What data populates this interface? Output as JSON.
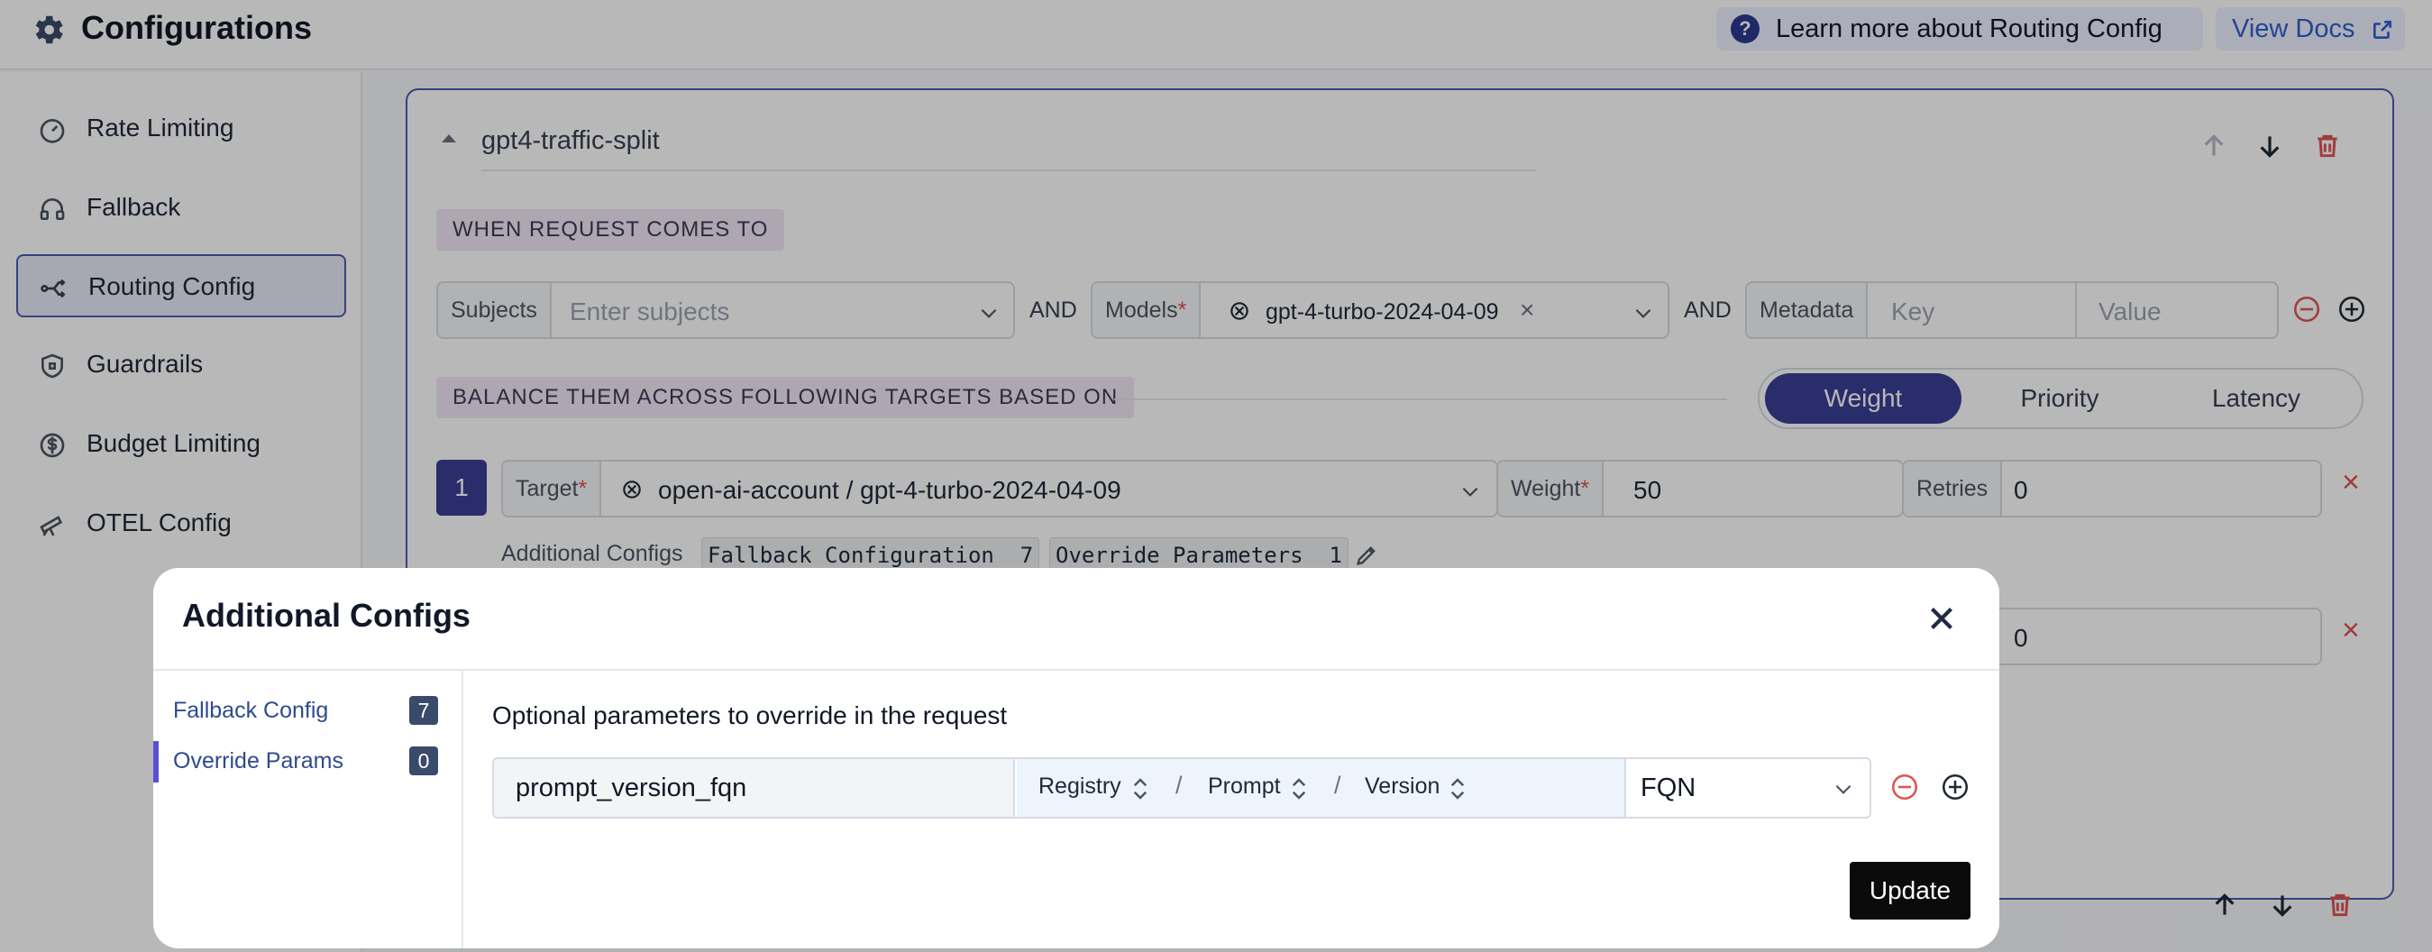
{
  "header": {
    "title": "Configurations",
    "learn_more": "Learn more about Routing Config",
    "view_docs": "View Docs"
  },
  "sidebar": {
    "items": [
      {
        "label": "Rate Limiting",
        "icon": "speedometer-icon"
      },
      {
        "label": "Fallback",
        "icon": "headset-icon"
      },
      {
        "label": "Routing Config",
        "icon": "routing-icon",
        "active": true
      },
      {
        "label": "Guardrails",
        "icon": "shield-icon"
      },
      {
        "label": "Budget Limiting",
        "icon": "dollar-icon"
      },
      {
        "label": "OTEL Config",
        "icon": "telescope-icon"
      }
    ]
  },
  "card": {
    "name": "gpt4-traffic-split",
    "when_label": "WHEN REQUEST COMES TO",
    "subjects_label": "Subjects",
    "subjects_placeholder": "Enter subjects",
    "and_1": "AND",
    "models_label": "Models",
    "model_value": "gpt-4-turbo-2024-04-09",
    "and_2": "AND",
    "metadata_label": "Metadata",
    "key_placeholder": "Key",
    "value_placeholder": "Value",
    "balance_label": "BALANCE THEM ACROSS FOLLOWING TARGETS BASED ON",
    "strategy_options": [
      "Weight",
      "Priority",
      "Latency"
    ],
    "target_index": "1",
    "target_label": "Target",
    "target_value": "open-ai-account / gpt-4-turbo-2024-04-09",
    "weight_label": "Weight",
    "weight_value": "50",
    "retries_label": "Retries",
    "retries_value": "0",
    "additional_configs": "Additional Configs",
    "fallback_badge": "Fallback Configuration",
    "fallback_count": "7",
    "override_badge": "Override Parameters",
    "override_count": "1",
    "retries_value_2": "0"
  },
  "modal": {
    "title": "Additional Configs",
    "nav": [
      {
        "label": "Fallback Config",
        "count": "7"
      },
      {
        "label": "Override Params",
        "count": "0",
        "active": true
      }
    ],
    "subtitle": "Optional parameters to override in the request",
    "param_key": "prompt_version_fqn",
    "seg_registry": "Registry",
    "seg_prompt": "Prompt",
    "seg_version": "Version",
    "slash": "/",
    "type_value": "FQN",
    "update_label": "Update"
  },
  "colors": {
    "accent": "#3a3f96",
    "danger": "#e05252",
    "link": "#2f5fcc"
  }
}
